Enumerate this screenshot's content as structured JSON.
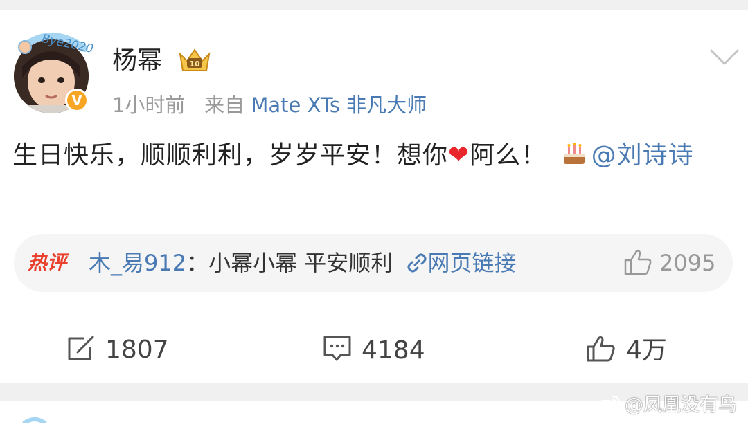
{
  "post": {
    "username": "杨幂",
    "time": "1小时前",
    "source_prefix": "来自",
    "source": "Mate XTs 非凡大师",
    "text_main": "生日快乐，顺顺利利，岁岁平安！想你",
    "text_after_heart": "阿么！",
    "mention": "@刘诗诗",
    "frame_text": "Bye2020"
  },
  "hot_comment": {
    "tag": "热评",
    "author": "木_易912",
    "separator": "：",
    "content": "小幂小幂 平安顺利 ",
    "link_text": "网页链接",
    "likes": "2095"
  },
  "actions": {
    "repost_count": "1807",
    "comment_count": "4184",
    "like_count": "4万"
  },
  "watermark": "@凤凰没有鸟",
  "icons": {
    "verify": "verified-v-icon",
    "crown": "crown-badge-icon",
    "chevron": "chevron-down-icon",
    "heart": "heart-emoji",
    "cake": "cake-emoji",
    "link": "link-icon",
    "thumb": "thumbs-up-icon",
    "repost": "repost-icon",
    "comment": "comment-icon"
  },
  "colors": {
    "link_blue": "#4a7ab3",
    "hot_red": "#e8422e",
    "verify_orange": "#f6a623",
    "heart_red": "#e8262b"
  }
}
